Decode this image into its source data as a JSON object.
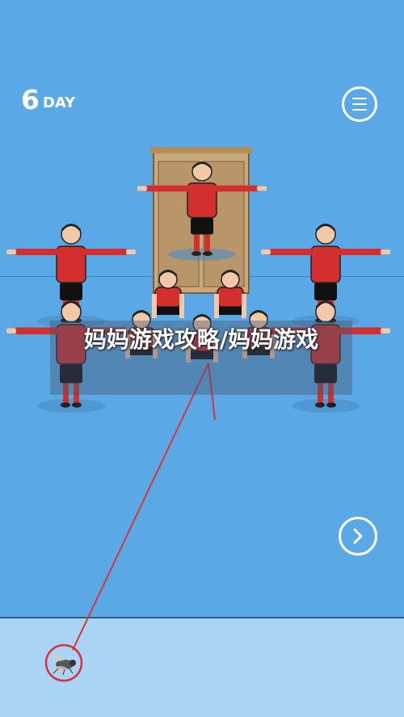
{
  "hud": {
    "day_number": "6",
    "day_label": "DAY",
    "menu_icon": "hamburger-menu-icon",
    "next_icon": "chevron-right-icon"
  },
  "overlay": {
    "caption": "妈妈游戏攻略/妈妈游戏"
  },
  "colors": {
    "background": "#5aa9e6",
    "ground": "#a9d4f5",
    "jersey": "#d32f2f",
    "laser": "#d9323a",
    "cabinet": "#c9a978"
  }
}
